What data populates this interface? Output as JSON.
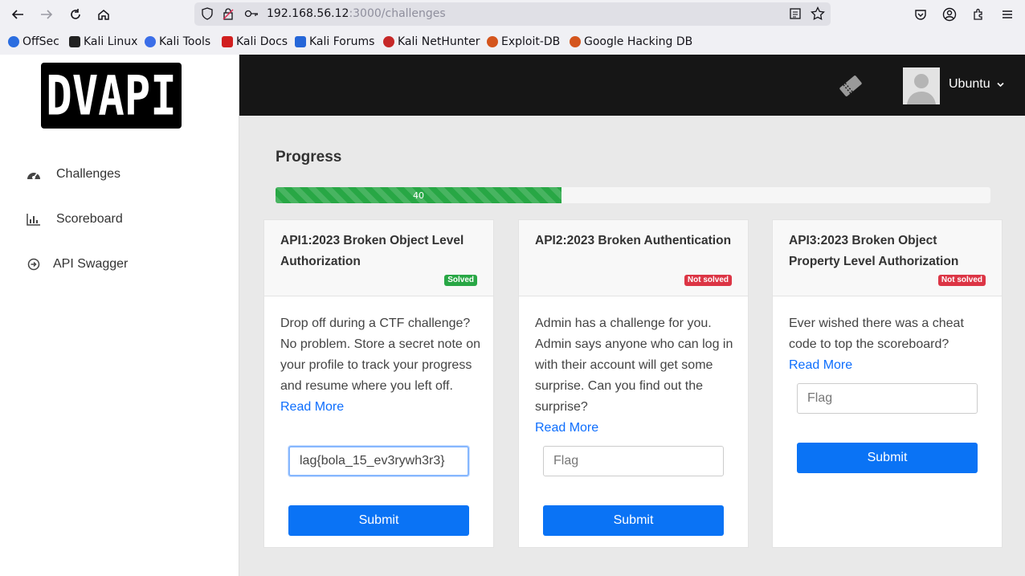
{
  "browser": {
    "url_host": "192.168.56.12",
    "url_path": ":3000/challenges",
    "bookmarks": [
      {
        "label": "OffSec",
        "icon": "offsec-icon",
        "color": "#2b6de0"
      },
      {
        "label": "Kali Linux",
        "icon": "kali-icon",
        "color": "#222222"
      },
      {
        "label": "Kali Tools",
        "icon": "kali-tools-icon",
        "color": "#3b6ee8"
      },
      {
        "label": "Kali Docs",
        "icon": "kali-docs-icon",
        "color": "#d11f1f"
      },
      {
        "label": "Kali Forums",
        "icon": "kali-forums-icon",
        "color": "#2566d8"
      },
      {
        "label": "Kali NetHunter",
        "icon": "nethunter-icon",
        "color": "#c62828"
      },
      {
        "label": "Exploit-DB",
        "icon": "exploit-db-icon",
        "color": "#d4551d"
      },
      {
        "label": "Google Hacking DB",
        "icon": "ghdb-icon",
        "color": "#d4551d"
      }
    ]
  },
  "sidebar": {
    "logo": "DVAPI",
    "items": [
      {
        "label": "Challenges",
        "icon": "dashboard-icon"
      },
      {
        "label": "Scoreboard",
        "icon": "bar-chart-icon"
      },
      {
        "label": "API Swagger",
        "icon": "arrow-circle-icon"
      }
    ]
  },
  "topbar": {
    "user_name": "Ubuntu",
    "ticket_icon": "ticket-icon"
  },
  "progress": {
    "title": "Progress",
    "value": 40,
    "label": "40",
    "color": "#28a745"
  },
  "challenges": [
    {
      "title": "API1:2023 Broken Object Level Authorization",
      "status": "Solved",
      "description": "Drop off during a CTF challenge? No problem. Store a secret note on your profile to track your progress and resume where you left off.",
      "read_more": "Read More",
      "flag_value": "lag{bola_15_ev3rywh3r3}",
      "flag_placeholder": "Flag",
      "submit": "Submit"
    },
    {
      "title": "API2:2023 Broken Authentication",
      "status": "Not solved",
      "description": "Admin has a challenge for you. Admin says anyone who can log in with their account will get some surprise. Can you find out the surprise?",
      "read_more": "Read More",
      "flag_value": "",
      "flag_placeholder": "Flag",
      "submit": "Submit"
    },
    {
      "title": "API3:2023 Broken Object Property Level Authorization",
      "status": "Not solved",
      "description": "Ever wished there was a cheat code to top the scoreboard?",
      "read_more": "Read More",
      "flag_value": "",
      "flag_placeholder": "Flag",
      "submit": "Submit"
    }
  ]
}
